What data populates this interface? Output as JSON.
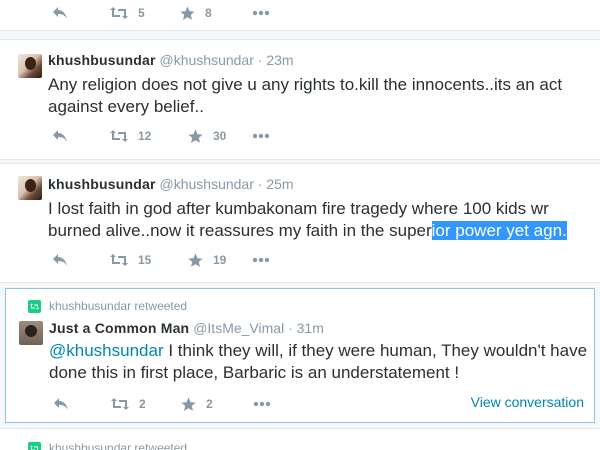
{
  "tweets": [
    {
      "stats": {
        "retweets": "5",
        "favorites": "8"
      }
    },
    {
      "fullname": "khushbusundar",
      "username": "@khushsundar",
      "separator": "·",
      "time": "23m",
      "text": "Any religion does not give u any rights to.kill the innocents..its an act against every belief..",
      "stats": {
        "retweets": "12",
        "favorites": "30"
      }
    },
    {
      "fullname": "khushbusundar",
      "username": "@khushsundar",
      "separator": "·",
      "time": "25m",
      "text_before_selection": "I lost faith in god after kumbakonam fire tragedy where 100 kids wr burned alive..now it reassures my faith in the super",
      "text_selected": "ior power yet agn.",
      "stats": {
        "retweets": "15",
        "favorites": "19"
      }
    },
    {
      "retweet_context": "khushbusundar retweeted",
      "fullname": "Just a Common Man",
      "username": "@ItsMe_Vimal",
      "separator": "·",
      "time": "31m",
      "mention": "@khushsundar",
      "text": " I think they will, if they were human, They wouldn't have done this in first place, Barbaric is an understatement !",
      "stats": {
        "retweets": "2",
        "favorites": "2"
      },
      "view_conversation": "View conversation"
    },
    {
      "retweet_context": "khushbusundar retweeted"
    }
  ],
  "icons": {
    "reply": "reply-icon",
    "retweet": "retweet-icon",
    "favorite": "star-icon",
    "more": "more-icon",
    "retweet_context": "retweet-badge-icon"
  },
  "colors": {
    "link": "#0084b4",
    "muted": "#8899a6",
    "text": "#292f33",
    "selection": "#3297fd",
    "retweet_green": "#19cf86",
    "highlight_border": "#8ec3e6"
  }
}
